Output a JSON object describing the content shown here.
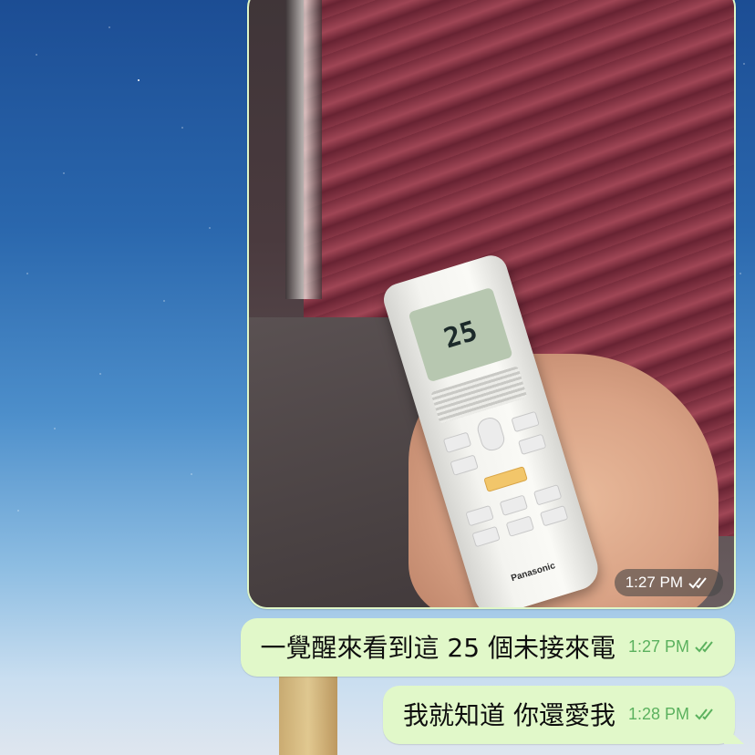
{
  "colors": {
    "bubble_bg": "#e1f8c9",
    "timestamp_green": "#5bb15e",
    "wallpaper_top": "#1c4d94",
    "wallpaper_bottom": "#dfe6ef"
  },
  "photo_message": {
    "remote_display": "25",
    "remote_brand": "Panasonic",
    "time": "1:27 PM",
    "status_icon": "double-check-icon"
  },
  "messages": [
    {
      "text": "一覺醒來看到這 25 個未接來電",
      "time": "1:27 PM",
      "status_icon": "double-check-icon"
    },
    {
      "text": "我就知道 你還愛我",
      "time": "1:28 PM",
      "status_icon": "double-check-icon"
    }
  ]
}
